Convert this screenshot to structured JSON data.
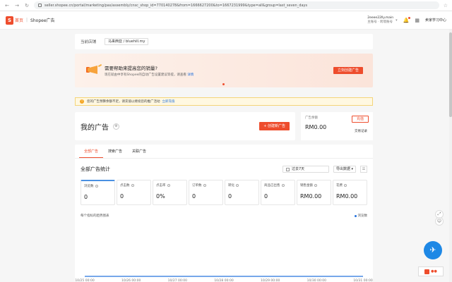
{
  "browser": {
    "url": "seller.shopee.cn/portal/marketing/pas/assembly/cnsc_shop_id=770140278&from=1666627200&to=1667231999&type=all&group=last_seven_days"
  },
  "header": {
    "brand": "首页",
    "breadcrumb": "Shopee广告",
    "shop_name": "2eeee22lly.main",
    "shop_sub": "主账号 · 跨境账号",
    "learn": "卖家学习中心"
  },
  "shop_row": {
    "label": "当前店铺",
    "selected": "马来西亚 / bluehill.my"
  },
  "banner": {
    "headline": "需要帮助来提高您的销量?",
    "sub": "现在就由中享有Shopee的自动广告设置建议等提，请查看",
    "sub_link": "详情",
    "button": "立刻创建广告"
  },
  "notice": {
    "text": "您的广告预算余额不足，请充值以继续您的推广活动",
    "link": "立即充值"
  },
  "myads": {
    "title": "我的广告",
    "create_button": "+ 创建新广告"
  },
  "balance": {
    "label": "广告余额",
    "value": "RM0.00",
    "topup": "充值",
    "tx_log": "交易记录"
  },
  "tabs": [
    "全部广告",
    "搜索广告",
    "关联广告"
  ],
  "stats": {
    "title": "全部广告统计",
    "date_range": "过去7天",
    "export": "导出数据",
    "metrics": [
      {
        "label": "浏览数",
        "value": "0"
      },
      {
        "label": "点击数",
        "value": "0"
      },
      {
        "label": "点击率",
        "value": "0%"
      },
      {
        "label": "订单数",
        "value": "0"
      },
      {
        "label": "转化",
        "value": "0"
      },
      {
        "label": "商品已出售",
        "value": "0"
      },
      {
        "label": "销售金额",
        "value": "RM0.00"
      },
      {
        "label": "花费",
        "value": "RM0.00"
      }
    ],
    "chart_title": "每个指标的趋势图表",
    "legend": "浏览数"
  },
  "chart_data": {
    "type": "line",
    "x": [
      "10/25 00:00",
      "10/26 00:00",
      "10/27 00:00",
      "10/28 00:00",
      "10/29 00:00",
      "10/30 00:00",
      "10/31 00:00"
    ],
    "series": [
      {
        "name": "浏览数",
        "values": [
          0,
          0,
          0,
          0,
          0,
          0,
          0
        ]
      }
    ],
    "color": "#2673dd"
  }
}
